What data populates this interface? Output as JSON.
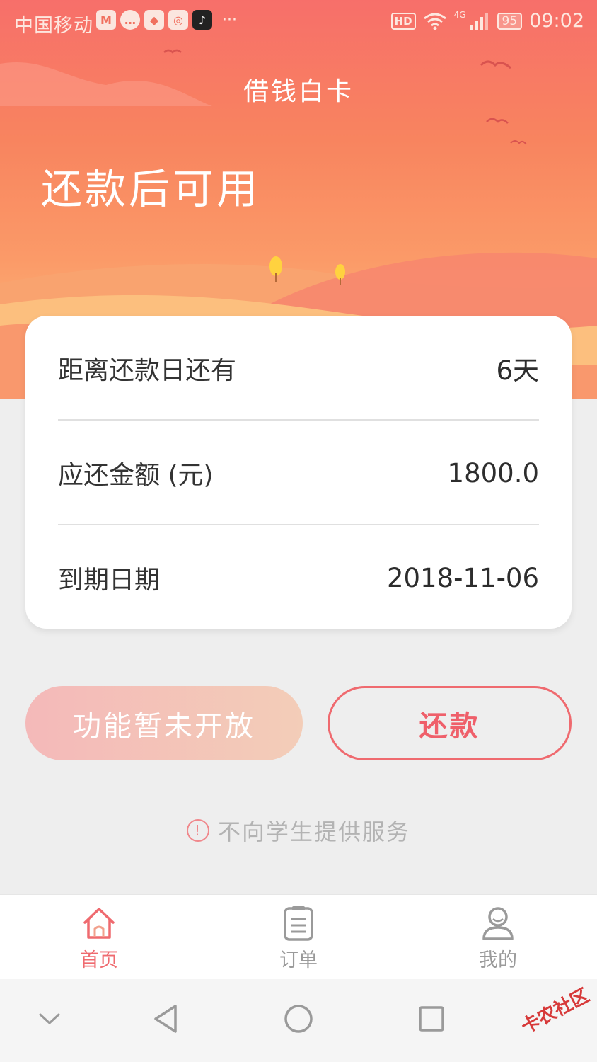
{
  "status_bar": {
    "carrier": "中国移动",
    "more": "···",
    "hd": "HD",
    "network": "4G",
    "battery": "95",
    "time": "09:02"
  },
  "header": {
    "app_title": "借钱白卡",
    "state_title": "还款后可用"
  },
  "loan_card": {
    "rows": [
      {
        "label": "距离还款日还有",
        "value": "6天"
      },
      {
        "label": "应还金额 (元)",
        "value": "1800.0"
      },
      {
        "label": "到期日期",
        "value": "2018-11-06"
      }
    ]
  },
  "actions": {
    "disabled_label": "功能暂未开放",
    "repay_label": "还款"
  },
  "notice": {
    "icon": "!",
    "text": "不向学生提供服务"
  },
  "tabbar": {
    "items": [
      {
        "label": "首页",
        "icon": "home-icon",
        "active": true
      },
      {
        "label": "订单",
        "icon": "order-list-icon",
        "active": false
      },
      {
        "label": "我的",
        "icon": "user-icon",
        "active": false
      }
    ]
  },
  "watermark": "卡农社区",
  "colors": {
    "accent": "#ef6a6f",
    "hero_top": "#f76f6a",
    "hero_bottom": "#fcc47f"
  }
}
